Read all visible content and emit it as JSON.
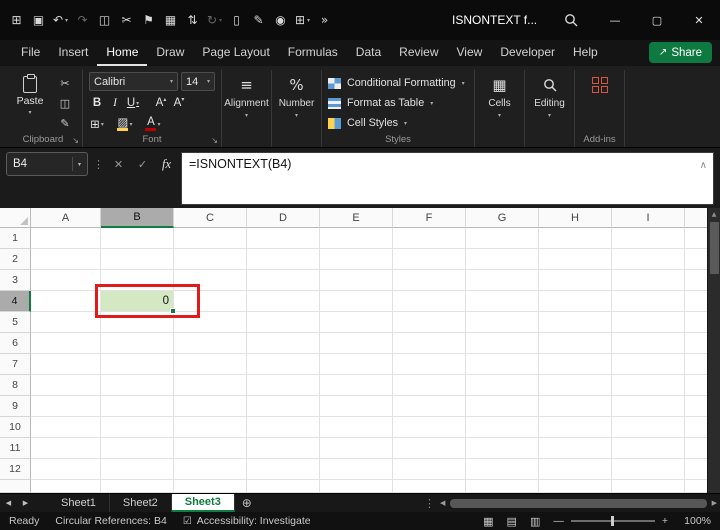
{
  "colors": {
    "accent_green": "#107c41",
    "annotation_red": "#e11b1b",
    "selected_cell_fill": "#d3e8c3",
    "share_green": "#0e7a41",
    "addins_red": "#d8543f",
    "font_color_red": "#c00000",
    "fill_color_yellow": "#ffd34d"
  },
  "titlebar": {
    "title": "ISNONTEXT f...",
    "qat": [
      {
        "name": "window-icon",
        "glyph": "⊞"
      },
      {
        "name": "save-icon",
        "glyph": "▣"
      },
      {
        "name": "undo-icon",
        "glyph": "↶",
        "chevron": true
      },
      {
        "name": "redo-icon",
        "glyph": "↷",
        "dim": true
      },
      {
        "name": "copy-icon",
        "glyph": "◫"
      },
      {
        "name": "cut-icon",
        "glyph": "✂"
      },
      {
        "name": "flag-icon",
        "glyph": "⚑"
      },
      {
        "name": "calculator-icon",
        "glyph": "▦"
      },
      {
        "name": "sort-icon",
        "glyph": "⇅"
      },
      {
        "name": "repeat-icon",
        "glyph": "↻",
        "dim": true,
        "chevron": true
      },
      {
        "name": "new-file-icon",
        "glyph": "▯"
      },
      {
        "name": "pen-icon",
        "glyph": "✎"
      },
      {
        "name": "camera-icon",
        "glyph": "◉"
      },
      {
        "name": "table-edit-icon",
        "glyph": "⊞",
        "chevron": true
      },
      {
        "name": "overflow-icon",
        "glyph": "»"
      }
    ],
    "window_controls": {
      "minimize": "—",
      "maximize": "▢",
      "close": "✕"
    }
  },
  "menu": {
    "tabs": [
      "File",
      "Insert",
      "Home",
      "Draw",
      "Page Layout",
      "Formulas",
      "Data",
      "Review",
      "View",
      "Developer",
      "Help"
    ],
    "active_tab": "Home",
    "share": {
      "label": "Share",
      "icon": "↗"
    }
  },
  "ribbon": {
    "clipboard": {
      "paste_label": "Paste",
      "group_label": "Clipboard",
      "small_icons": [
        {
          "name": "cut-icon",
          "glyph": "✂"
        },
        {
          "name": "copy-icon",
          "glyph": "◫"
        },
        {
          "name": "format-painter-icon",
          "glyph": "✎"
        }
      ]
    },
    "font": {
      "font_name": "Calibri",
      "font_size": "14",
      "bold": "B",
      "italic": "I",
      "underline": "U",
      "increase_font": "A",
      "increase_mark": "▴",
      "decrease_font": "A",
      "decrease_mark": "▾",
      "borders_glyph": "⊞",
      "fill_glyph": "▨",
      "font_color_glyph": "A",
      "group_label": "Font"
    },
    "alignment": {
      "label": "Alignment",
      "icon": "≡"
    },
    "number": {
      "label": "Number",
      "icon": "%"
    },
    "styles": {
      "group_label": "Styles",
      "items": [
        "Conditional Formatting",
        "Format as Table",
        "Cell Styles"
      ]
    },
    "cells": {
      "label": "Cells",
      "icon": "▦"
    },
    "editing": {
      "label": "Editing"
    },
    "addins": {
      "label": "Add-ins"
    }
  },
  "formula_bar": {
    "name_box": "B4",
    "dots": "⋮",
    "cancel_glyph": "✕",
    "enter_glyph": "✓",
    "fx_label": "fx",
    "collapse_glyph": "∧",
    "formula": "=ISNONTEXT(B4)"
  },
  "grid": {
    "columns": [
      "A",
      "B",
      "C",
      "D",
      "E",
      "F",
      "G",
      "H",
      "I"
    ],
    "rows": [
      1,
      2,
      3,
      4,
      5,
      6,
      7,
      8,
      9,
      10,
      11,
      12
    ],
    "selected": {
      "col": "B",
      "row": 4,
      "value": "0"
    }
  },
  "sheet_bar": {
    "nav_left": "◀",
    "nav_right": "▶",
    "tabs": [
      {
        "label": "Sheet1",
        "active": false
      },
      {
        "label": "Sheet2",
        "active": false
      },
      {
        "label": "Sheet3",
        "active": true
      }
    ],
    "add_glyph": "⊕",
    "dots": "⋮",
    "scroll_left": "◀",
    "scroll_right": "▶"
  },
  "status_bar": {
    "ready": "Ready",
    "circular_refs": "Circular References: B4",
    "accessibility_icon": "☑",
    "accessibility": "Accessibility: Investigate",
    "view_icons": [
      {
        "name": "normal-view-icon",
        "glyph": "▦"
      },
      {
        "name": "page-layout-view-icon",
        "glyph": "▤"
      },
      {
        "name": "page-break-view-icon",
        "glyph": "▥"
      }
    ],
    "zoom_out": "—",
    "zoom_in": "+",
    "zoom_level": "100%"
  }
}
